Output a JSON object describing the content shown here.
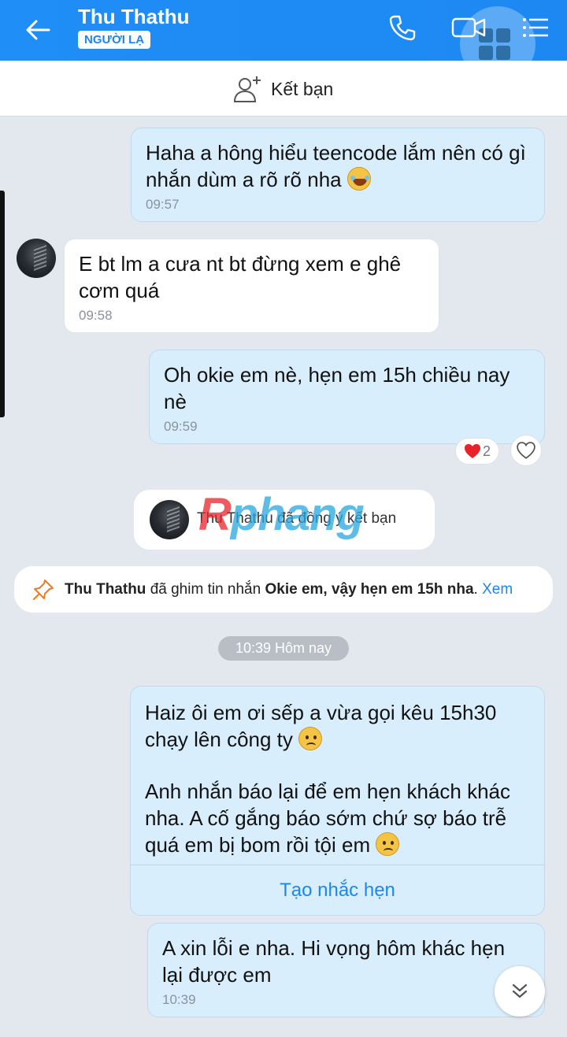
{
  "header": {
    "contact_name": "Thu Thathu",
    "badge": "NGƯỜI LẠ"
  },
  "add_friend": {
    "label": "Kết bạn"
  },
  "messages": [
    {
      "from": "me",
      "text": "Haha a hông hiểu teencode lắm nên có gì nhắn dùm a rõ rõ nha",
      "emoji": "laugh-icon",
      "time": "09:57"
    },
    {
      "from": "them",
      "text": "E bt lm a cưa nt bt đừng xem e ghê cơm quá",
      "time": "09:58"
    },
    {
      "from": "me",
      "text": "Oh okie em nè, hẹn em 15h chiều nay nè",
      "time": "09:59",
      "reaction_count": "2"
    }
  ],
  "system": {
    "friend_accepted": "Thu Thathu đã đồng ý kết bạn"
  },
  "watermark": {
    "part1": "R",
    "part2": "phang"
  },
  "pin": {
    "who": "Thu Thathu",
    "action": " đã ghim tin nhắn ",
    "message": "Okie em, vậy hẹn em 15h nha",
    "dot": ".",
    "view": " Xem"
  },
  "date_chip": "10:39 Hôm nay",
  "big_message": {
    "line1": "Haiz ôi em ơi sếp a vừa gọi kêu 15h30 chạy lên công ty",
    "line2": "Anh nhắn báo lại để em hẹn khách khác nha. A cố gắng báo sớm chứ sợ báo trễ quá em bị bom rồi tội em",
    "action": "Tạo nhắc hẹn"
  },
  "last_message": {
    "text": "A xin lỗi e nha. Hi vọng hôm khác hẹn lại được em",
    "time": "10:39"
  },
  "colors": {
    "header": "#1e88f2",
    "my_bubble": "#d9eefc",
    "background": "#e3e8ee",
    "link": "#1b87f0"
  }
}
